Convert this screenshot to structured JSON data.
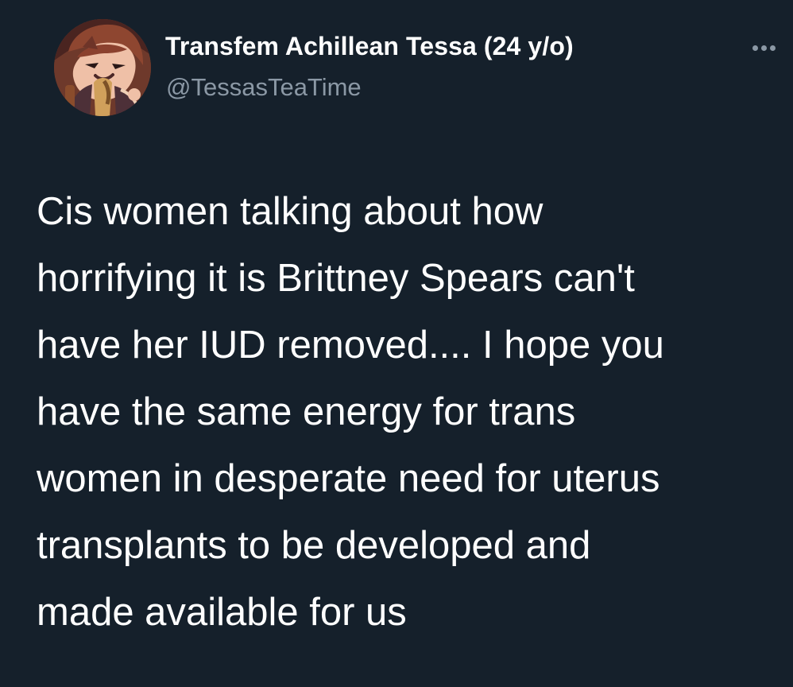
{
  "tweet": {
    "author": {
      "display_name": "Transfem Achillean Tessa (24 y/o)",
      "handle": "@TessasTeaTime",
      "avatar_icon": "cartoon-avatar"
    },
    "more_icon": "more-options-icon",
    "text": "Cis women talking about how\nhorrifying it is Brittney Spears can't\nhave her IUD removed.... I hope you\nhave the same energy for trans\nwomen in desperate need for uterus\ntransplants to be developed and\nmade available for us"
  },
  "colors": {
    "background": "#15202b",
    "text": "#ffffff",
    "secondary_text": "#8b98a5"
  }
}
